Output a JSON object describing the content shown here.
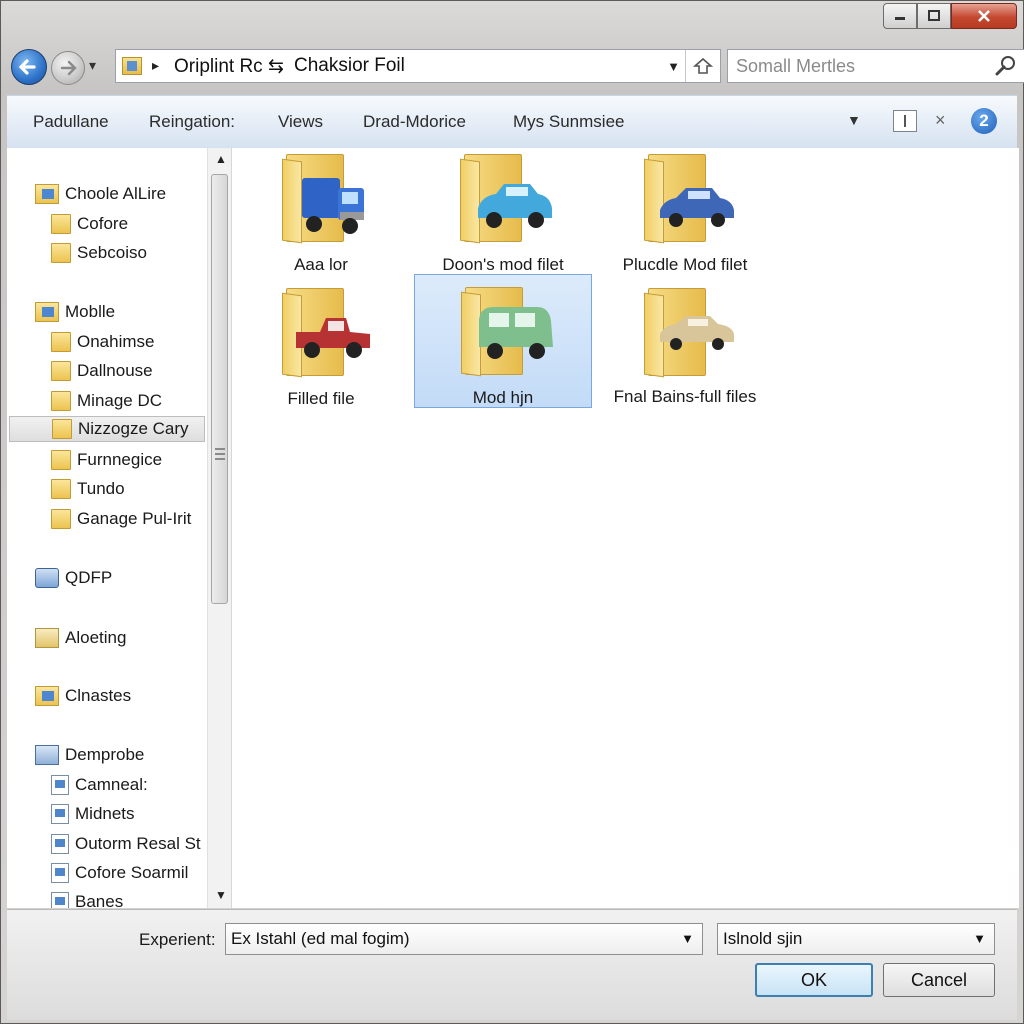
{
  "window": {
    "title_buttons": [
      "minimize-icon",
      "maximize-icon",
      "close-icon"
    ]
  },
  "nav": {
    "dropdown_glyph": "▾",
    "address": {
      "separator": "▸",
      "crumb1": "Oriplint Rc ⇆",
      "crumb2": "Chaksior Foil",
      "dropdown_arrow": "▼"
    },
    "search": {
      "placeholder": "Somall Mertles"
    }
  },
  "toolbar": {
    "items": [
      "Padullane",
      "Reingation:",
      "Views",
      "Drad-Mdorice",
      "Mys Sunmsiee"
    ],
    "views_arrow": "▼",
    "close_glyph": "×",
    "help_label": "2"
  },
  "tree": {
    "groups": [
      {
        "label": "Choole AlLire",
        "children": [
          "Cofore",
          "Sebcoiso"
        ]
      },
      {
        "label": "Moblle",
        "children": [
          "Onahimse",
          "Dallnouse",
          "Minage DC",
          "Nizzogze Cary",
          "Furnnegice",
          "Tundo",
          "Ganage Pul-Irit"
        ]
      },
      {
        "label": "QDFP",
        "children": []
      },
      {
        "label": "Aloeting",
        "children": []
      },
      {
        "label": "Clnastes",
        "children": []
      },
      {
        "label": "Demprobe",
        "children": [
          "Camneal:",
          "Midnets",
          "Outorm Resal St",
          "Cofore Soarmil",
          "Banes"
        ]
      }
    ],
    "selected": "Nizzogze Cary",
    "scroll_up": "▲",
    "scroll_down": "▼"
  },
  "files": [
    {
      "label": "Aaa lor",
      "vehicle": "blue-truck-icon",
      "color": "#2f63c6"
    },
    {
      "label": "Doon's mod filet",
      "vehicle": "light-blue-sedan-icon",
      "color": "#43a9dc"
    },
    {
      "label": "Plucdle Mod filet",
      "vehicle": "blue-sedan-icon",
      "color": "#3f67b8"
    },
    {
      "label": "Filled file",
      "vehicle": "red-pickup-icon",
      "color": "#b73232"
    },
    {
      "label": "Mod hjn",
      "vehicle": "green-van-icon",
      "color": "#7fbf8d"
    },
    {
      "label": "Fnal Bains-full files",
      "vehicle": "beige-car-icon",
      "color": "#d8c69a"
    }
  ],
  "bottom": {
    "filename_label": "Experient:",
    "filename_value": "Ex Istahl (ed mal fogim)",
    "filetype_value": "Islnold sjin",
    "combo_arrow": "▼",
    "ok_label": "OK",
    "cancel_label": "Cancel"
  },
  "colors": {
    "accent": "#3c7fb1",
    "selection": "#c3dbf7",
    "close_red": "#c44931"
  }
}
